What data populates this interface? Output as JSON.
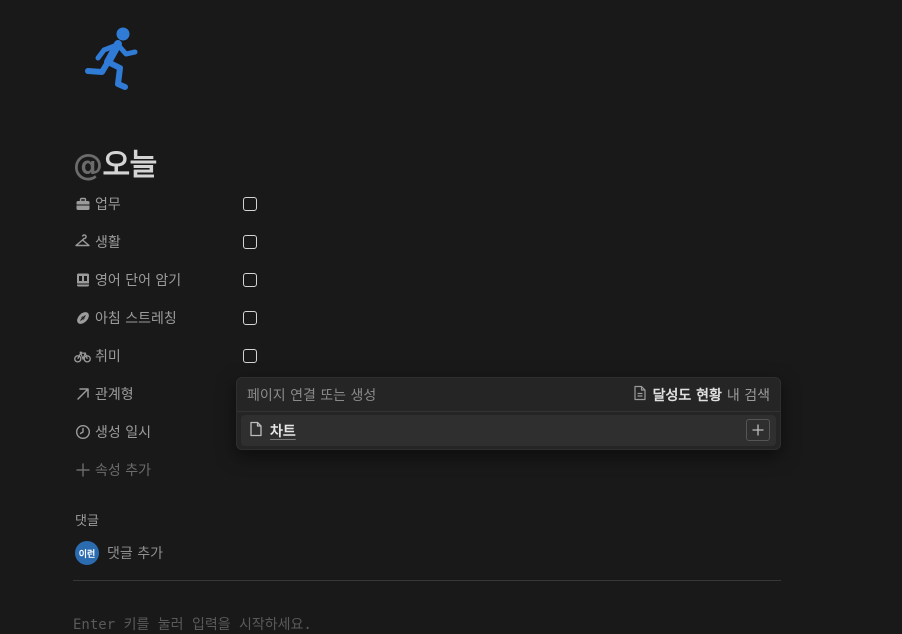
{
  "page": {
    "icon": "running-person-icon",
    "icon_color": "#2f7bd6",
    "title_mention": "@",
    "title": "오늘"
  },
  "properties": [
    {
      "label": "업무",
      "icon": "briefcase-icon",
      "checked": false
    },
    {
      "label": "생활",
      "icon": "hanger-icon",
      "checked": false
    },
    {
      "label": "영어 단어 암기",
      "icon": "book-icon",
      "checked": false
    },
    {
      "label": "아침 스트레칭",
      "icon": "football-icon",
      "checked": false
    },
    {
      "label": "취미",
      "icon": "bicycle-icon",
      "checked": false
    },
    {
      "label": "관계형",
      "icon": "arrow-up-right-icon"
    },
    {
      "label": "생성 일시",
      "icon": "clock-icon"
    }
  ],
  "add_property": "속성 추가",
  "comments": {
    "label": "댓글",
    "avatar_text": "이런",
    "add_label": "댓글 추가"
  },
  "editor_placeholder": "Enter 키를 눌러 입력을 시작하세요.",
  "relation_popup": {
    "search_placeholder": "페이지 연결 또는 생성",
    "scope_db": "달성도 현황",
    "scope_suffix": "내 검색",
    "results": [
      {
        "name": "차트"
      }
    ]
  },
  "colors": {
    "background": "#191919",
    "accent": "#2f7bd6",
    "avatar": "#2b6cb0"
  }
}
